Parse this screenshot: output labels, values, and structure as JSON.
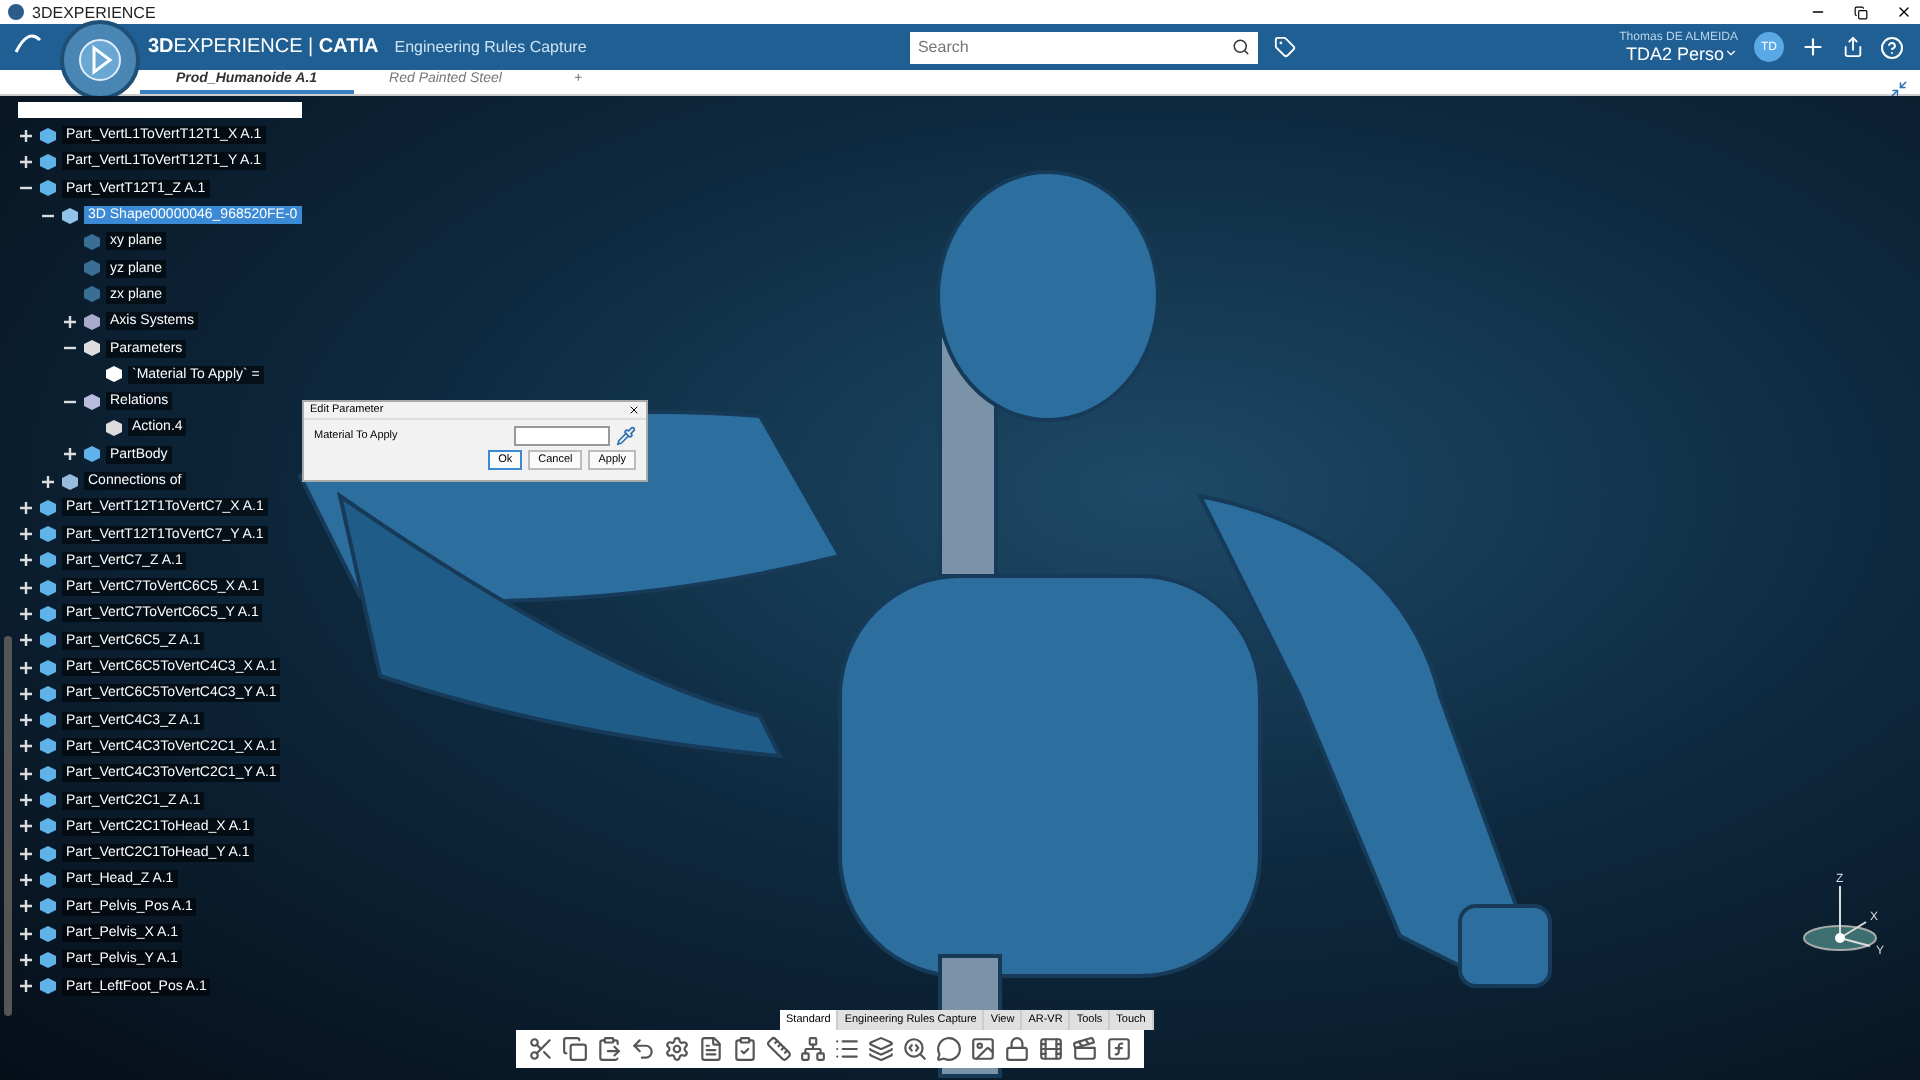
{
  "window": {
    "title": "3DEXPERIENCE"
  },
  "header": {
    "brand": "**3D**EXPERIENCE | **CATIA**",
    "app": "Engineering Rules Capture",
    "search": {
      "placeholder": "Search"
    },
    "user_name": "Thomas DE ALMEIDA",
    "workspace": "TDA2 Perso",
    "avatar": "TD"
  },
  "tabs": [
    {
      "label": "Prod_Humanoide A.1",
      "selected": true
    },
    {
      "label": "Red Painted Steel",
      "selected": false
    },
    {
      "label": "+",
      "selected": false
    }
  ],
  "tree": [
    {
      "label": "Part_VertL1ToVertT12T1_X A.1",
      "kind": "part",
      "expanded": false
    },
    {
      "label": "Part_VertL1ToVertT12T1_Y A.1",
      "kind": "part",
      "expanded": false
    },
    {
      "label": "Part_VertT12T1_Z A.1",
      "kind": "part",
      "expanded": true,
      "children": [
        {
          "label": "3D Shape00000046_968520FE-0",
          "kind": "shape",
          "expanded": true,
          "selected": true,
          "children": [
            {
              "label": "xy plane",
              "kind": "plane"
            },
            {
              "label": "yz plane",
              "kind": "plane"
            },
            {
              "label": "zx plane",
              "kind": "plane"
            },
            {
              "label": "Axis Systems",
              "kind": "axis",
              "expanded": false
            },
            {
              "label": "Parameters",
              "kind": "params",
              "expanded": true,
              "children": [
                {
                  "label": "`Material To Apply` =",
                  "kind": "param"
                }
              ]
            },
            {
              "label": "Relations",
              "kind": "relations",
              "expanded": true,
              "children": [
                {
                  "label": "Action.4",
                  "kind": "action"
                }
              ]
            },
            {
              "label": "PartBody",
              "kind": "body",
              "expanded": false
            }
          ]
        },
        {
          "label": "Connections of",
          "kind": "connections",
          "expanded": false
        }
      ]
    },
    {
      "label": "Part_VertT12T1ToVertC7_X A.1",
      "kind": "part",
      "expanded": false
    },
    {
      "label": "Part_VertT12T1ToVertC7_Y A.1",
      "kind": "part",
      "expanded": false
    },
    {
      "label": "Part_VertC7_Z A.1",
      "kind": "part",
      "expanded": false
    },
    {
      "label": "Part_VertC7ToVertC6C5_X A.1",
      "kind": "part",
      "expanded": false
    },
    {
      "label": "Part_VertC7ToVertC6C5_Y A.1",
      "kind": "part",
      "expanded": false
    },
    {
      "label": "Part_VertC6C5_Z A.1",
      "kind": "part",
      "expanded": false
    },
    {
      "label": "Part_VertC6C5ToVertC4C3_X A.1",
      "kind": "part",
      "expanded": false
    },
    {
      "label": "Part_VertC6C5ToVertC4C3_Y A.1",
      "kind": "part",
      "expanded": false
    },
    {
      "label": "Part_VertC4C3_Z A.1",
      "kind": "part",
      "expanded": false
    },
    {
      "label": "Part_VertC4C3ToVertC2C1_X A.1",
      "kind": "part",
      "expanded": false
    },
    {
      "label": "Part_VertC4C3ToVertC2C1_Y A.1",
      "kind": "part",
      "expanded": false
    },
    {
      "label": "Part_VertC2C1_Z A.1",
      "kind": "part",
      "expanded": false
    },
    {
      "label": "Part_VertC2C1ToHead_X A.1",
      "kind": "part",
      "expanded": false
    },
    {
      "label": "Part_VertC2C1ToHead_Y A.1",
      "kind": "part",
      "expanded": false
    },
    {
      "label": "Part_Head_Z A.1",
      "kind": "part",
      "expanded": false
    },
    {
      "label": "Part_Pelvis_Pos A.1",
      "kind": "part",
      "expanded": false
    },
    {
      "label": "Part_Pelvis_X A.1",
      "kind": "part",
      "expanded": false
    },
    {
      "label": "Part_Pelvis_Y A.1",
      "kind": "part",
      "expanded": false
    },
    {
      "label": "Part_LeftFoot_Pos A.1",
      "kind": "part",
      "expanded": false
    }
  ],
  "dialog": {
    "title": "Edit Parameter",
    "label": "Material To Apply",
    "buttons": [
      {
        "label": "Ok",
        "selected": true
      },
      {
        "label": "Cancel",
        "selected": false
      },
      {
        "label": "Apply",
        "selected": false
      }
    ]
  },
  "compass": {
    "axes": [
      "Z",
      "X",
      "Y"
    ]
  },
  "toolbar": {
    "tabs": [
      {
        "label": "Standard",
        "selected": true
      },
      {
        "label": "Engineering Rules Capture",
        "selected": false
      },
      {
        "label": "View",
        "selected": false
      },
      {
        "label": "AR-VR",
        "selected": false
      },
      {
        "label": "Tools",
        "selected": false
      },
      {
        "label": "Touch",
        "selected": false
      }
    ]
  }
}
